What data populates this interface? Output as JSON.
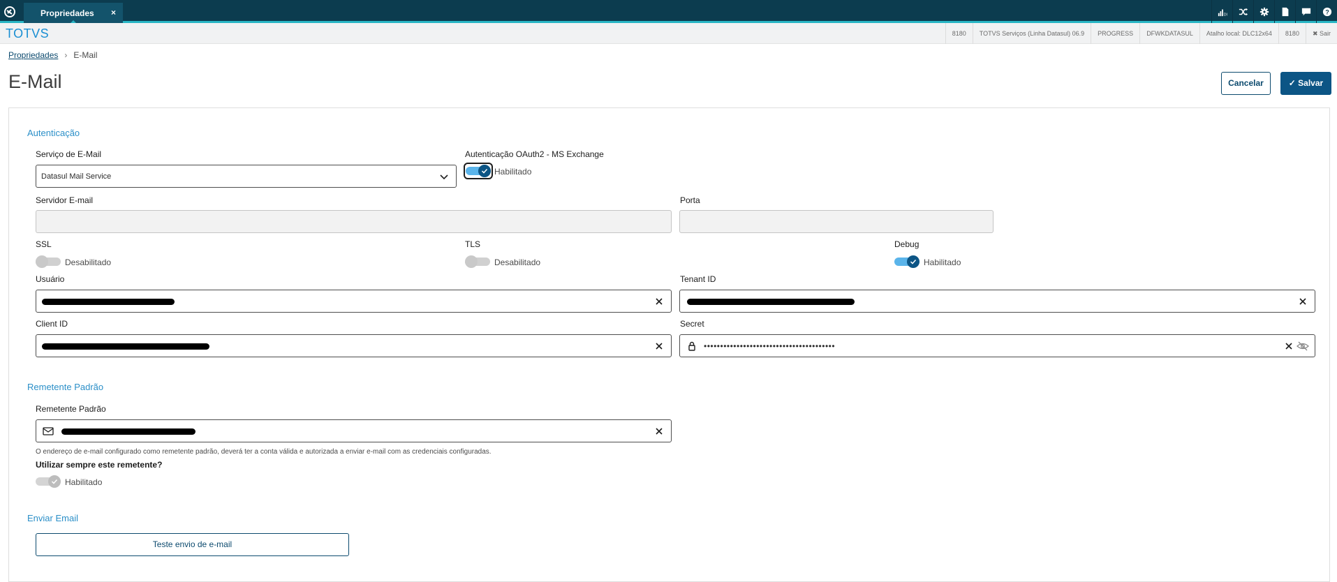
{
  "topbar": {
    "tab_label": "Propriedades",
    "tab_close": "×",
    "tools": [
      "analytics-icon",
      "shuffle-icon",
      "gear-icon",
      "document-icon",
      "chat-icon",
      "help-icon"
    ]
  },
  "subbar": {
    "brand": "TOTVS",
    "infos": [
      "8180",
      "TOTVS Serviços (Linha Datasul) 06.9",
      "PROGRESS",
      "DFWKDATASUL",
      "Atalho local: DLC12x64",
      "8180",
      "✖ Sair"
    ]
  },
  "breadcrumb": {
    "parent": "Propriedades",
    "separator": "›",
    "current": "E-Mail"
  },
  "page": {
    "title": "E-Mail",
    "cancel_label": "Cancelar",
    "save_label": "✓ Salvar"
  },
  "auth": {
    "section_title": "Autenticação",
    "email_service": {
      "label": "Serviço de E-Mail",
      "value": "Datasul Mail Service"
    },
    "oauth": {
      "label": "Autenticação OAuth2 - MS Exchange",
      "state": "Habilitado",
      "enabled": true
    },
    "server": {
      "label": "Servidor E-mail",
      "value": ""
    },
    "port": {
      "label": "Porta",
      "value": ""
    },
    "ssl": {
      "label": "SSL",
      "state": "Desabilitado",
      "enabled": false
    },
    "tls": {
      "label": "TLS",
      "state": "Desabilitado",
      "enabled": false
    },
    "debug": {
      "label": "Debug",
      "state": "Habilitado",
      "enabled": true
    },
    "user": {
      "label": "Usuário"
    },
    "tenant": {
      "label": "Tenant ID"
    },
    "client": {
      "label": "Client ID"
    },
    "secret": {
      "label": "Secret",
      "value": "••••••••••••••••••••••••••••••••••••••••"
    }
  },
  "sender": {
    "section_title": "Remetente Padrão",
    "label": "Remetente Padrão",
    "hint": "O endereço de e-mail configurado como remetente padrão, deverá ter a conta válida e autorizada a enviar e-mail com as credenciais configuradas.",
    "always_label": "Utilizar sempre este remetente?",
    "always_state": "Habilitado"
  },
  "send": {
    "section_title": "Enviar Email",
    "test_button": "Teste envio de e-mail"
  },
  "colors": {
    "primary": "#0c5585",
    "topbar": "#0c3c4f",
    "accent": "#29b6c5",
    "link": "#2b8fc8"
  }
}
